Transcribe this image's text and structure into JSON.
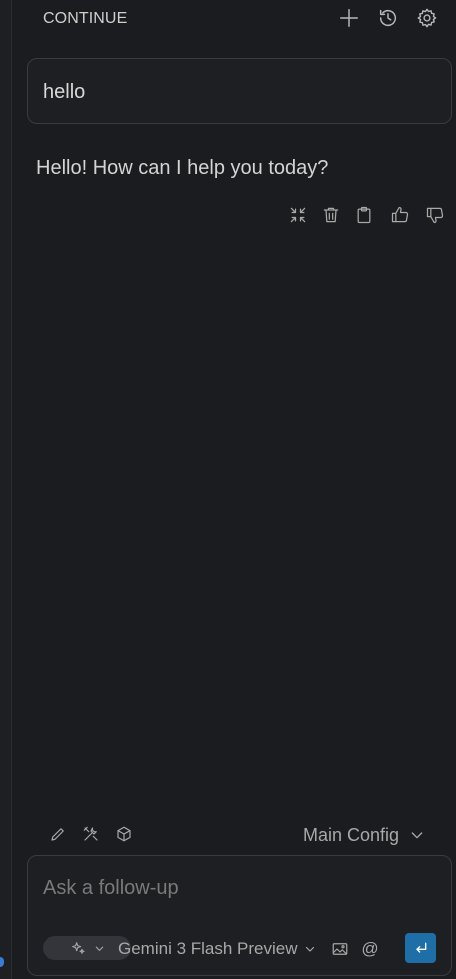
{
  "header": {
    "title": "CONTINUE",
    "icons": [
      "plus-icon",
      "history-icon",
      "gear-icon"
    ]
  },
  "conversation": {
    "user_message": "hello",
    "assistant_message": "Hello! How can I help you today?",
    "actions": [
      "collapse-icon",
      "trash-icon",
      "clipboard-icon",
      "thumbs-up-icon",
      "thumbs-down-icon"
    ]
  },
  "toolbar": {
    "icons": [
      "pencil-icon",
      "tools-icon",
      "cube-icon"
    ],
    "config_label": "Main Config"
  },
  "input": {
    "placeholder": "Ask a follow-up",
    "value": "",
    "model_label": "Gemini 3 Flash Preview",
    "icons": [
      "sparkle-icon",
      "image-icon",
      "at-icon",
      "enter-icon"
    ]
  },
  "colors": {
    "background": "#1b1c1f",
    "panel": "#1e1f22",
    "border": "#3a3b40",
    "accent": "#1e6fa8",
    "text": "#d4d4d4",
    "muted_text": "#a8a8a8"
  }
}
